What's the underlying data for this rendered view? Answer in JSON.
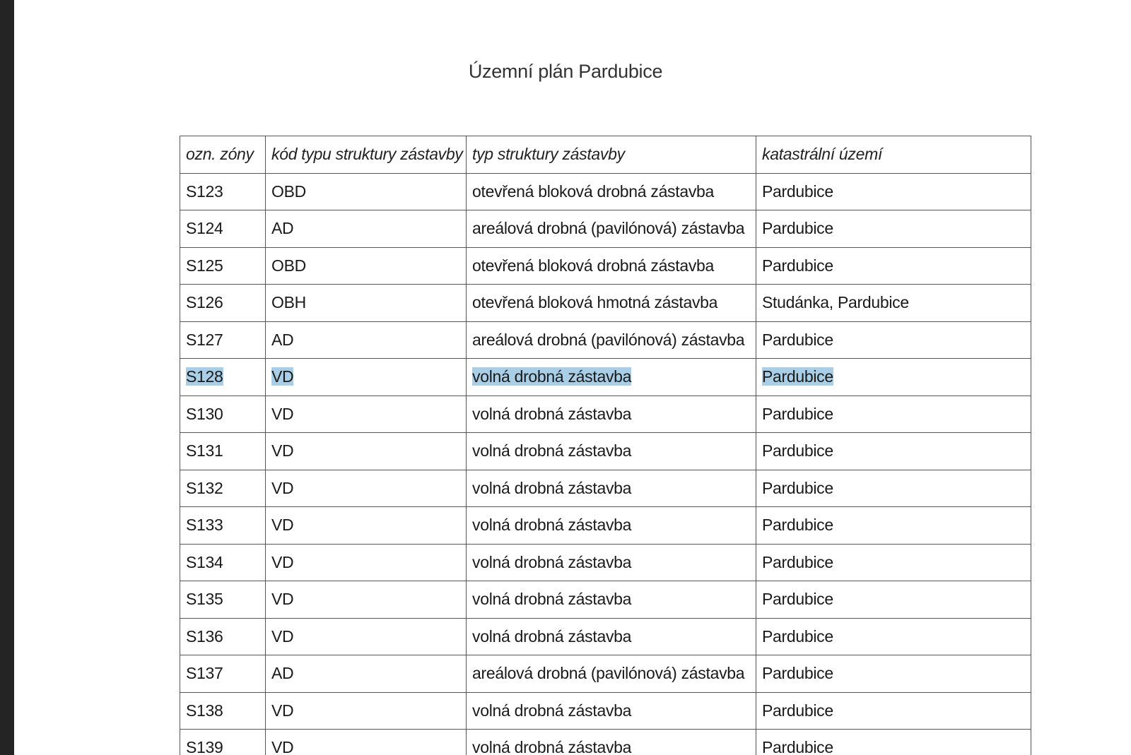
{
  "document": {
    "title": "Územní plán Pardubice"
  },
  "table": {
    "headers": [
      "ozn. zóny",
      "kód typu struktury zástavby",
      "typ struktury zástavby",
      "katastrální území"
    ],
    "rows": [
      [
        "S123",
        "OBD",
        "otevřená bloková drobná zástavba",
        "Pardubice"
      ],
      [
        "S124",
        "AD",
        "areálová drobná (pavilónová) zástavba",
        "Pardubice"
      ],
      [
        "S125",
        "OBD",
        "otevřená bloková drobná zástavba",
        "Pardubice"
      ],
      [
        "S126",
        "OBH",
        "otevřená bloková hmotná zástavba",
        "Studánka, Pardubice"
      ],
      [
        "S127",
        "AD",
        "areálová drobná (pavilónová) zástavba",
        "Pardubice"
      ],
      [
        "S128",
        "VD",
        "volná drobná zástavba",
        "Pardubice"
      ],
      [
        "S130",
        "VD",
        "volná drobná zástavba",
        "Pardubice"
      ],
      [
        "S131",
        "VD",
        "volná drobná zástavba",
        "Pardubice"
      ],
      [
        "S132",
        "VD",
        "volná drobná zástavba",
        "Pardubice"
      ],
      [
        "S133",
        "VD",
        "volná drobná zástavba",
        "Pardubice"
      ],
      [
        "S134",
        "VD",
        "volná drobná zástavba",
        "Pardubice"
      ],
      [
        "S135",
        "VD",
        "volná drobná zástavba",
        "Pardubice"
      ],
      [
        "S136",
        "VD",
        "volná drobná zástavba",
        "Pardubice"
      ],
      [
        "S137",
        "AD",
        "areálová drobná (pavilónová) zástavba",
        "Pardubice"
      ],
      [
        "S138",
        "VD",
        "volná drobná zástavba",
        "Pardubice"
      ],
      [
        "S139",
        "VD",
        "volná drobná zástavba",
        "Pardubice"
      ]
    ],
    "selected_row": 5
  },
  "colors": {
    "selection_highlight": "#a9cee6",
    "viewer_background": "#242424",
    "border": "#555555"
  }
}
